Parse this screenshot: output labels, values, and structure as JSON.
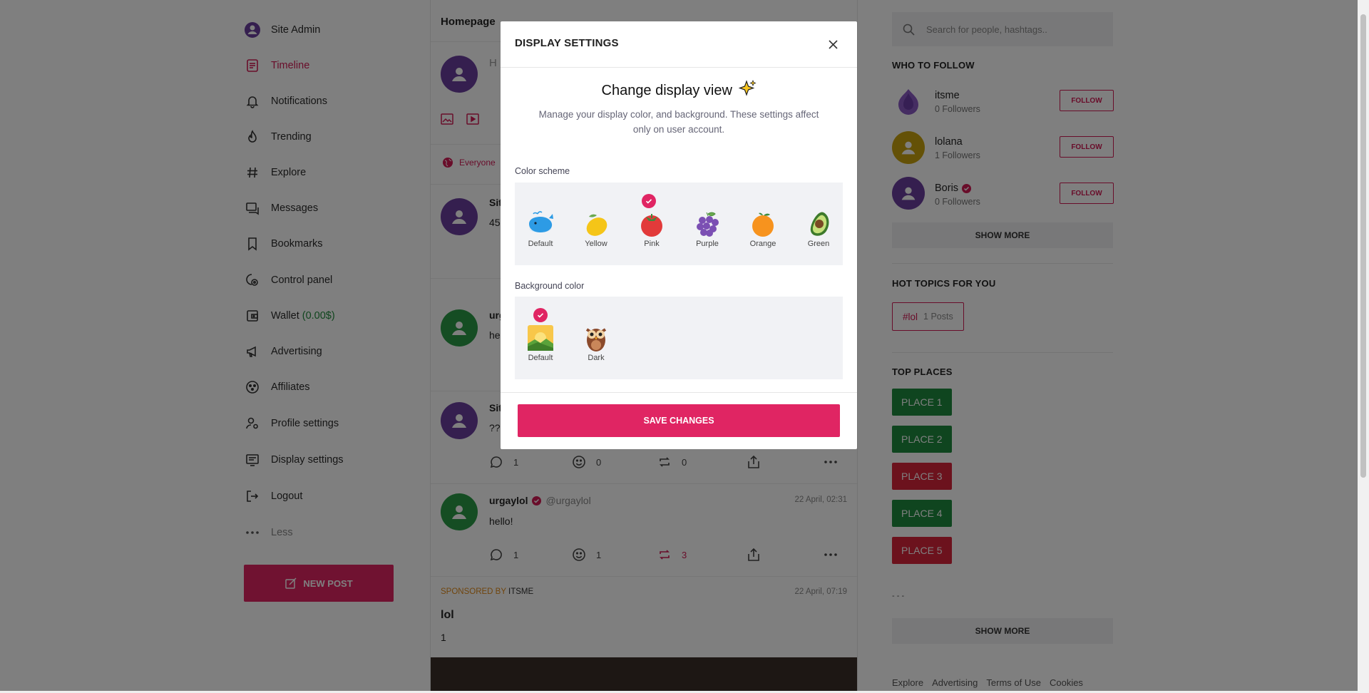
{
  "sidebar": {
    "items": [
      {
        "label": "Site Admin",
        "icon": "avatar-icon"
      },
      {
        "label": "Timeline",
        "icon": "timeline-icon"
      },
      {
        "label": "Notifications",
        "icon": "bell-icon"
      },
      {
        "label": "Trending",
        "icon": "flame-icon"
      },
      {
        "label": "Explore",
        "icon": "hashtag-icon"
      },
      {
        "label": "Messages",
        "icon": "messages-icon"
      },
      {
        "label": "Bookmarks",
        "icon": "bookmark-icon"
      },
      {
        "label": "Control panel",
        "icon": "control-panel-icon"
      },
      {
        "label": "Wallet",
        "value": "(0.00$)",
        "icon": "wallet-icon"
      },
      {
        "label": "Advertising",
        "icon": "megaphone-icon"
      },
      {
        "label": "Affiliates",
        "icon": "affiliates-icon"
      },
      {
        "label": "Profile settings",
        "icon": "profile-settings-icon"
      },
      {
        "label": "Display settings",
        "icon": "display-icon"
      },
      {
        "label": "Logout",
        "icon": "logout-icon"
      },
      {
        "label": "Less",
        "icon": "more-dots-icon"
      }
    ],
    "new_post": "NEW POST"
  },
  "center": {
    "header": "Homepage",
    "composer_placeholder": "H",
    "audience": "Everyone",
    "posts": [
      {
        "name_partial": "Sit",
        "text_partial": "45"
      },
      {
        "name_partial": "urg",
        "text_partial": "he"
      },
      {
        "name_partial": "Sit",
        "text_partial": "??",
        "comments": "1",
        "reactions": "0",
        "reposts": "0"
      },
      {
        "name": "urgaylol",
        "handle": "@urgaylol",
        "time": "22 April, 02:31",
        "text": "hello!",
        "comments": "1",
        "reactions": "1",
        "reposts": "3"
      }
    ],
    "sponsored": {
      "prefix": "SPONSORED BY",
      "by": "ITSME",
      "time": "22 April, 07:19",
      "title": "lol",
      "body": "1"
    }
  },
  "right": {
    "search_placeholder": "Search for people, hashtags..",
    "who_to_follow": "WHO TO FOLLOW",
    "follow_label": "FOLLOW",
    "users": [
      {
        "name": "itsme",
        "followers": "0 Followers"
      },
      {
        "name": "lolana",
        "followers": "1 Followers"
      },
      {
        "name": "Boris",
        "followers": "0 Followers"
      }
    ],
    "show_more": "SHOW MORE",
    "hot_topics": "HOT TOPICS FOR YOU",
    "topic": {
      "tag": "#lol",
      "count": "1 Posts"
    },
    "top_places": "TOP PLACES",
    "places": [
      "PLACE 1",
      "PLACE 2",
      "PLACE 3",
      "PLACE 4",
      "PLACE 5"
    ],
    "place_colors": [
      "#1e8a3e",
      "#1e8a3e",
      "#d8243a",
      "#1e8a3e",
      "#d8243a"
    ],
    "ellipsis": "- - -",
    "footer_links": [
      "Explore",
      "Advertising",
      "Terms of Use",
      "Cookies"
    ]
  },
  "modal": {
    "header": "DISPLAY SETTINGS",
    "title": "Change display view",
    "title_icon": "sparkles-icon",
    "description": "Manage your display color, and background. These settings affect only on user account.",
    "color_scheme_label": "Color scheme",
    "color_schemes": [
      {
        "label": "Default",
        "icon": "whale-emoji"
      },
      {
        "label": "Yellow",
        "icon": "lemon-emoji"
      },
      {
        "label": "Pink",
        "icon": "tomato-emoji",
        "selected": true
      },
      {
        "label": "Purple",
        "icon": "grapes-emoji"
      },
      {
        "label": "Orange",
        "icon": "orange-emoji"
      },
      {
        "label": "Green",
        "icon": "avocado-emoji"
      }
    ],
    "background_label": "Background color",
    "backgrounds": [
      {
        "label": "Default",
        "icon": "sunrise-emoji",
        "selected": true
      },
      {
        "label": "Dark",
        "icon": "owl-emoji"
      }
    ],
    "save_label": "SAVE CHANGES"
  },
  "colors": {
    "accent": "#e02563",
    "overlay": "rgba(0,0,0,0.5)"
  }
}
